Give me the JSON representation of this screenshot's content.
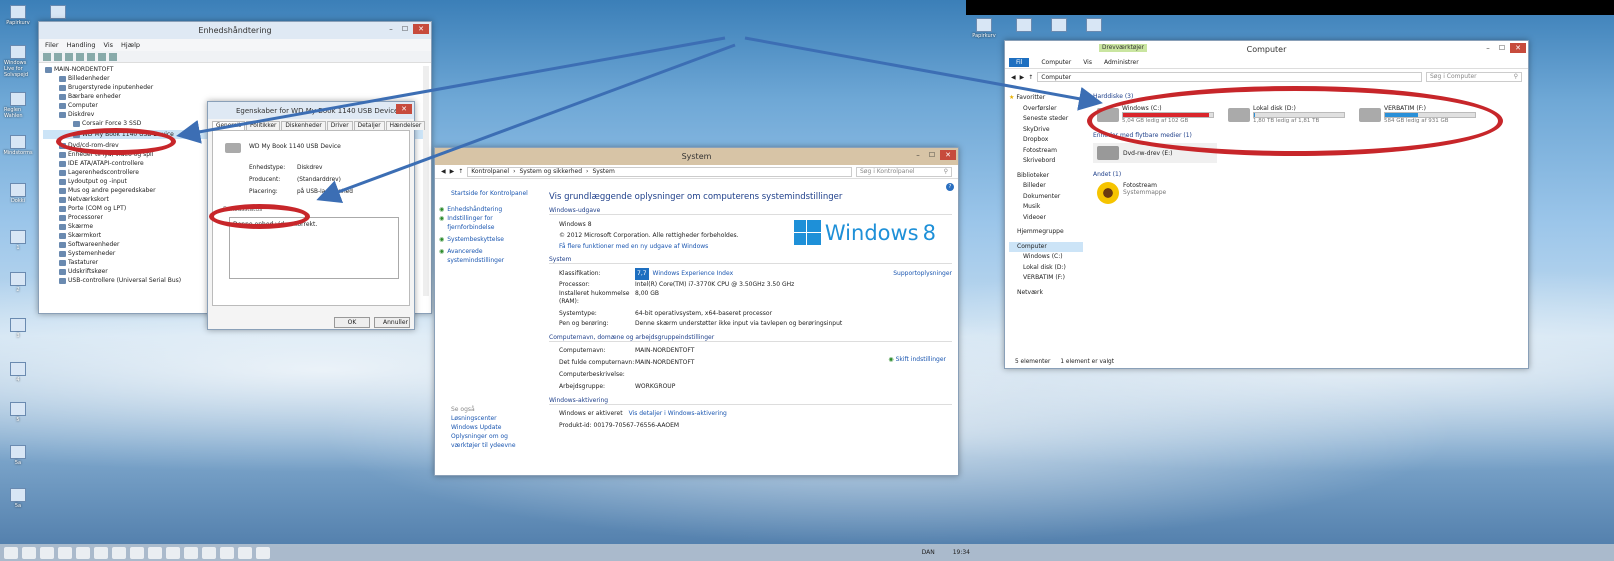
{
  "desktop": {
    "icons_left": [
      "Papirkurv",
      "Windows Live for Solvspejd",
      "Reglen Wahlen",
      "Mindstorms",
      "Dokki",
      "1",
      "2",
      "3",
      "4",
      "5",
      "5a",
      "10",
      "1",
      "1",
      "19",
      "5a"
    ],
    "icons_right": [
      "Papirkurv"
    ]
  },
  "devmgr": {
    "title": "Enhedshåndtering",
    "menu": [
      "Filer",
      "Handling",
      "Vis",
      "Hjælp"
    ],
    "tree": [
      "MAIN-NORDENTOFT",
      "Billedenheder",
      "Brugerstyrede inputenheder",
      "Bærbare enheder",
      "Computer",
      "Diskdrev",
      "Corsair Force 3 SSD",
      "WD My Book 1140 USB Device",
      "Dvd/cd-rom-drev",
      "Enheder til lyd, video og spil",
      "IDE ATA/ATAPI-controllere",
      "Lagerenhedscontrollere",
      "Lydoutput og -input",
      "Mus og andre pegeredskaber",
      "Netværkskort",
      "Porte (COM og LPT)",
      "Processorer",
      "Skærme",
      "Skærmkort",
      "Softwareenheder",
      "Systemenheder",
      "Tastaturer",
      "Udskriftskøer",
      "USB-controllere (Universal Serial Bus)"
    ]
  },
  "props": {
    "title": "Egenskaber for WD My Book 1140 USB Device",
    "tabs": [
      "Generelt",
      "Politikker",
      "Diskenheder",
      "Driver",
      "Detaljer",
      "Hændelser"
    ],
    "device": "WD My Book 1140 USB Device",
    "k1": "Enhedstype:",
    "v1": "Diskdrev",
    "k2": "Producent:",
    "v2": "(Standarddrev)",
    "k3": "Placering:",
    "v3": "på USB-lagerenhed",
    "status_label": "Enhedsstatus",
    "status": "Denne enhed virker korrekt.",
    "ok": "OK",
    "cancel": "Annuller"
  },
  "system": {
    "title": "System",
    "crumbs": [
      "Kontrolpanel",
      "System og sikkerhed",
      "System"
    ],
    "search": "Søg i Kontrolpanel",
    "left": [
      "Startside for Kontrolpanel",
      "Enhedshåndtering",
      "Indstillinger for fjernforbindelse",
      "Systembeskyttelse",
      "Avancerede systemindstillinger"
    ],
    "see_also": "Se også",
    "see": [
      "Løsningscenter",
      "Windows Update",
      "Oplysninger om og værktøjer til ydeevne"
    ],
    "heading": "Vis grundlæggende oplysninger om computerens systemindstillinger",
    "ed_h": "Windows-udgave",
    "ed": "Windows 8",
    "copy": "© 2012 Microsoft Corporation. Alle rettigheder forbeholdes.",
    "more": "Få flere funktioner med en ny udgave af Windows",
    "logo": "Windows",
    "logo8": "8",
    "sys_h": "System",
    "rating_k": "Klassifikation:",
    "rating": "7,7",
    "wei": "Windows Experience Index",
    "support": "Supportoplysninger",
    "rows": [
      [
        "Processor:",
        "Intel(R) Core(TM) i7-3770K CPU @ 3.50GHz   3.50 GHz"
      ],
      [
        "Installeret hukommelse (RAM):",
        "8,00 GB"
      ],
      [
        "Systemtype:",
        "64-bit operativsystem, x64-baseret processor"
      ],
      [
        "Pen og berøring:",
        "Denne skærm understøtter ikke input via tavlepen og berøringsinput"
      ]
    ],
    "net_h": "Computernavn, domæne og arbejdsgruppeindstillinger",
    "change": "Skift indstillinger",
    "net": [
      [
        "Computernavn:",
        "MAIN-NORDENTOFT"
      ],
      [
        "Det fulde computernavn:",
        "MAIN-NORDENTOFT"
      ],
      [
        "Computerbeskrivelse:",
        ""
      ],
      [
        "Arbejdsgruppe:",
        "WORKGROUP"
      ]
    ],
    "act_h": "Windows-aktivering",
    "act": "Windows er aktiveret",
    "act_link": "Vis detaljer i Windows-aktivering",
    "pid": "Produkt-id: 00179-70567-76556-AAOEM"
  },
  "explorer": {
    "title": "Computer",
    "ribbon_ctx": "Drevværktøjer",
    "tabs": [
      "Fil",
      "Computer",
      "Vis",
      "Administrer"
    ],
    "path": "Computer",
    "search": "Søg i Computer",
    "nav": [
      "Favoritter",
      "Overførsler",
      "Seneste steder",
      "SkyDrive",
      "Dropbox",
      "Fotostream",
      "Skrivebord",
      "Biblioteker",
      "Billeder",
      "Dokumenter",
      "Musik",
      "Videoer",
      "Hjemmegruppe",
      "Computer",
      "Windows (C:)",
      "Lokal disk (D:)",
      "VERBATIM (F:)",
      "Netværk"
    ],
    "hd_h": "Harddiske (3)",
    "drives": [
      {
        "name": "Windows (C:)",
        "free": "5,04 GB ledig af 102 GB",
        "pct": 0.95,
        "color": "#d9262c"
      },
      {
        "name": "Lokal disk (D:)",
        "free": "1,80 TB ledig af 1,81 TB",
        "pct": 0.01,
        "color": "#2a90d8"
      },
      {
        "name": "VERBATIM (F:)",
        "free": "584 GB ledig af 931 GB",
        "pct": 0.37,
        "color": "#2a90d8"
      }
    ],
    "rem_h": "Enheder med flytbare medier (1)",
    "dvd": "Dvd-rw-drev (E:)",
    "other_h": "Andet (1)",
    "foto": "Fotostream",
    "foto_sub": "Systemmappe",
    "status_left": "5 elementer",
    "status_sel": "1 element er valgt"
  },
  "taskbar": {
    "lang": "DAN",
    "time": "19:34"
  }
}
